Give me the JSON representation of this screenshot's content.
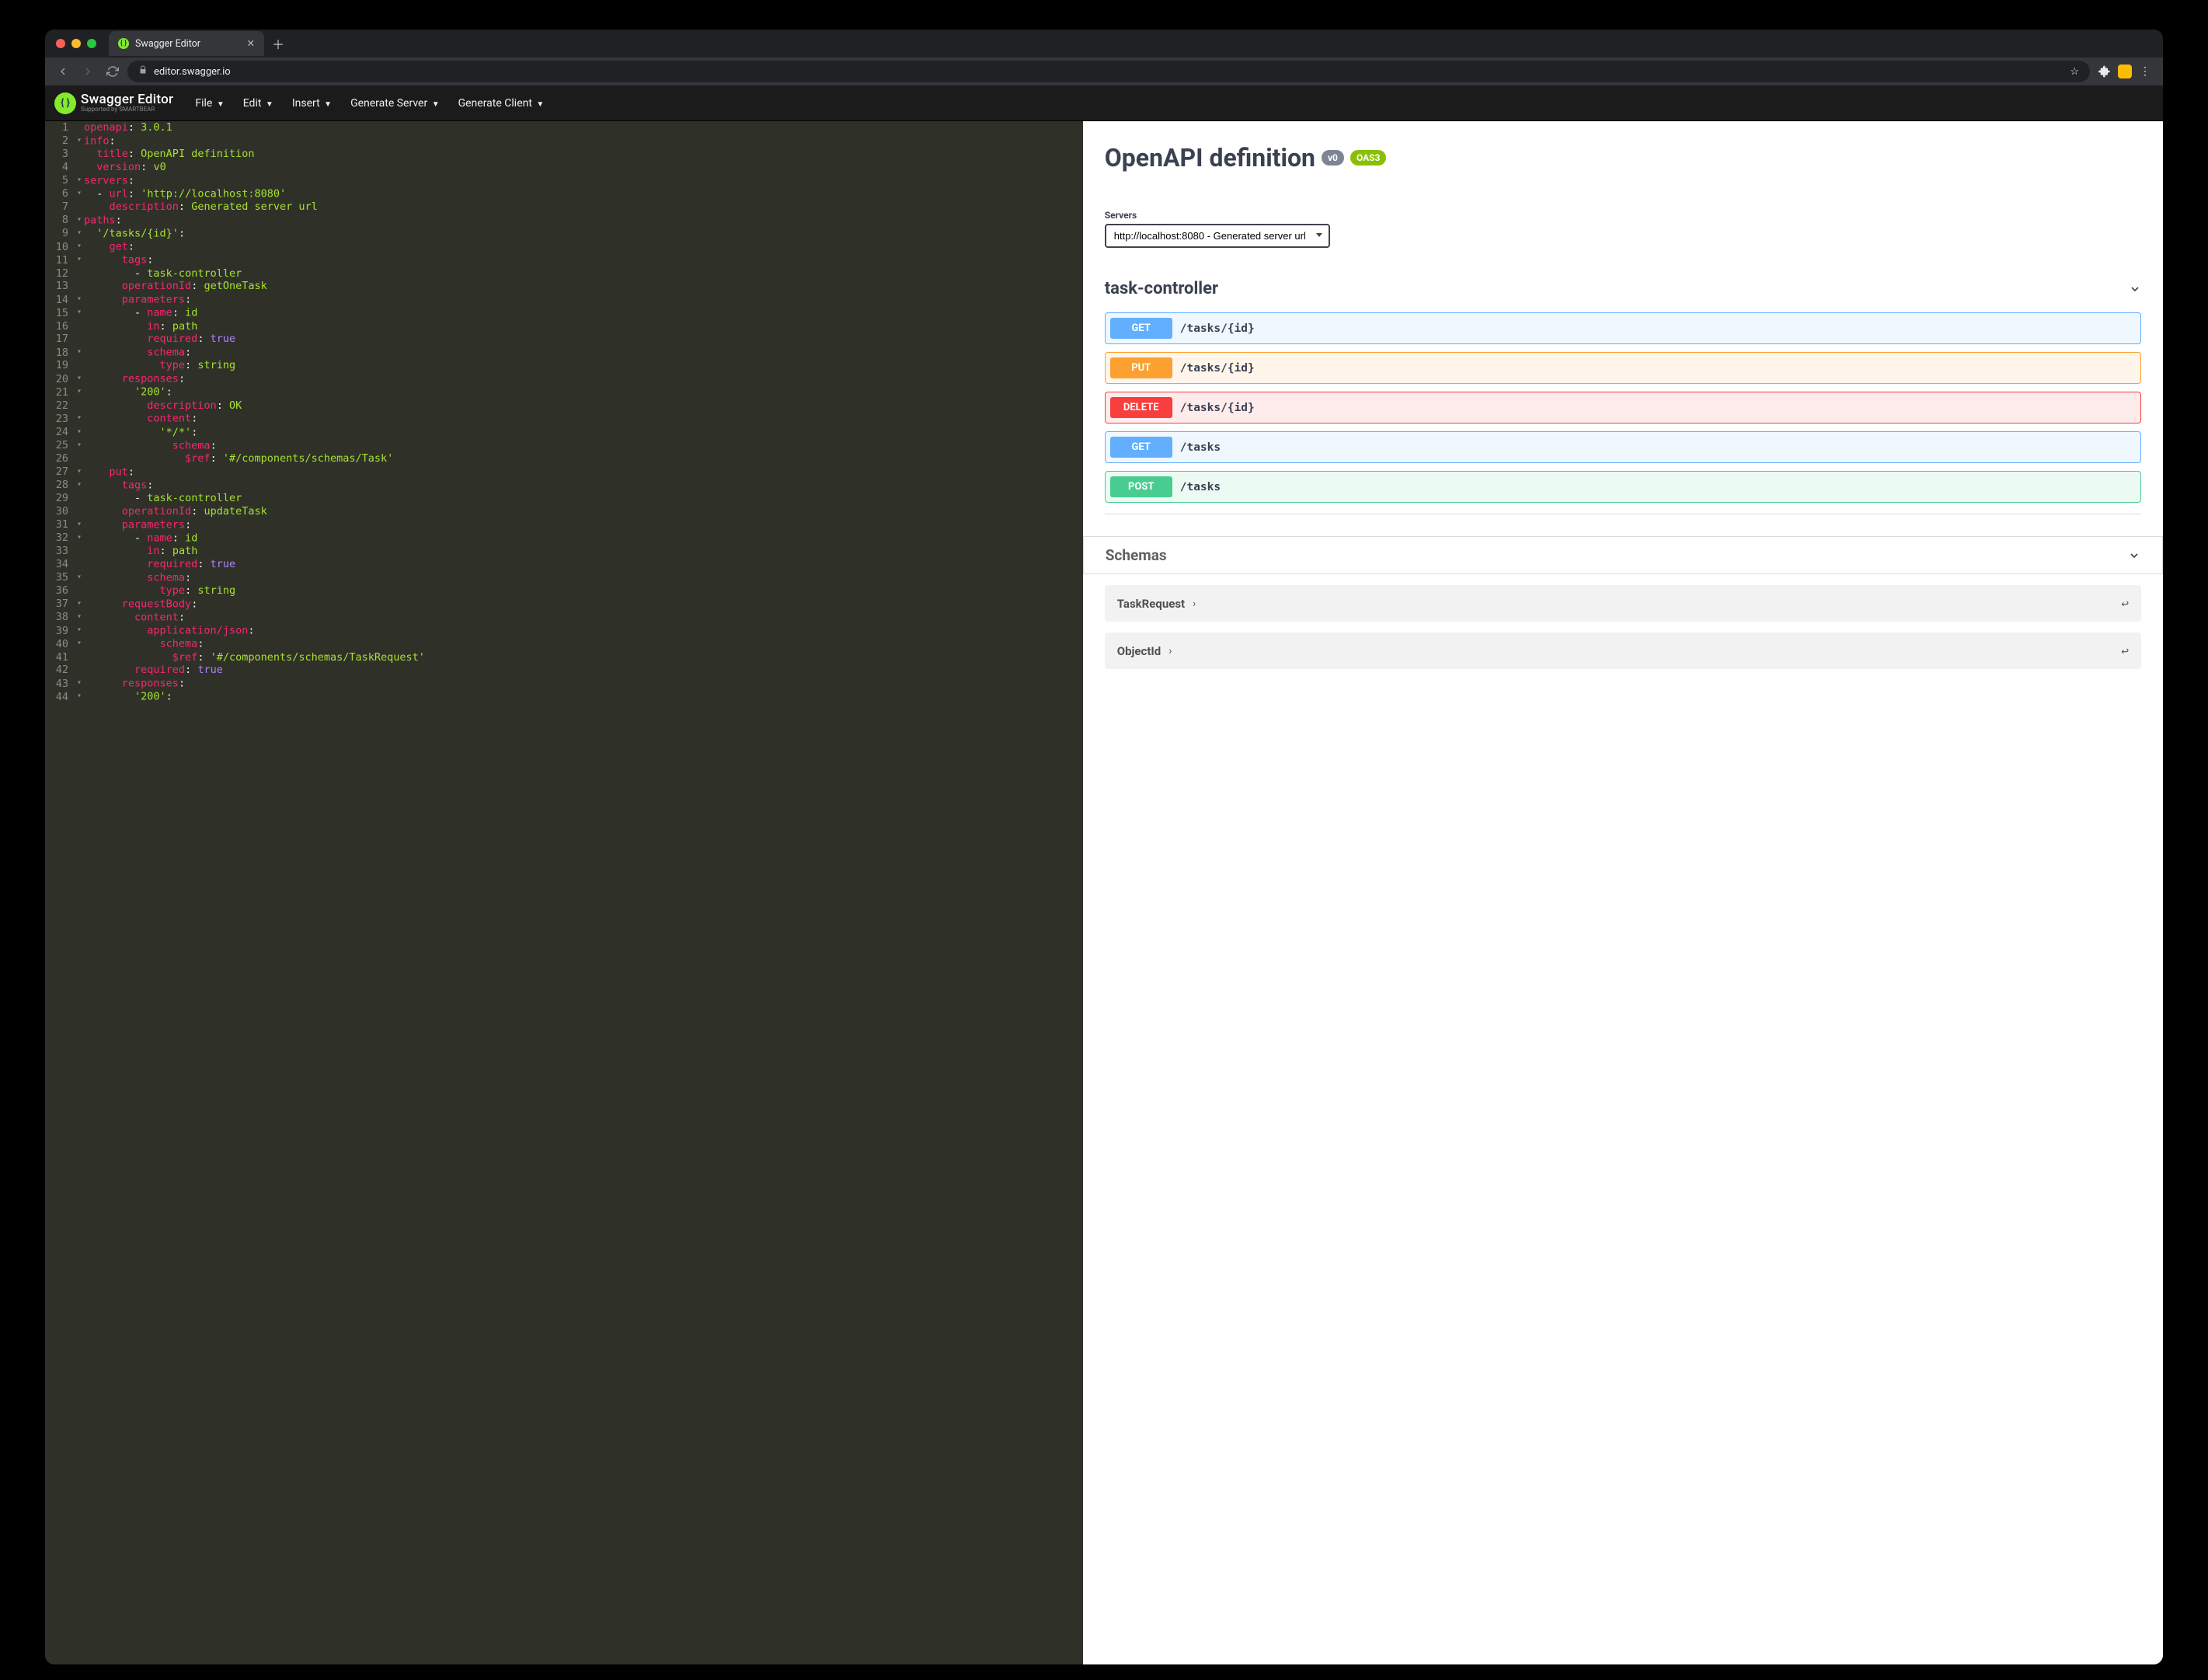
{
  "browser": {
    "tab_title": "Swagger Editor",
    "url": "editor.swagger.io"
  },
  "header": {
    "brand": "Swagger Editor",
    "brand_sub": "Supported by SMARTBEAR",
    "menus": [
      "File",
      "Edit",
      "Insert",
      "Generate Server",
      "Generate Client"
    ]
  },
  "editor": {
    "lines": [
      {
        "n": 1,
        "fold": "",
        "segs": [
          [
            "k-key",
            "openapi"
          ],
          [
            "k-punc",
            ": "
          ],
          [
            "k-str",
            "3.0.1"
          ]
        ]
      },
      {
        "n": 2,
        "fold": "▾",
        "segs": [
          [
            "k-key",
            "info"
          ],
          [
            "k-punc",
            ":"
          ]
        ]
      },
      {
        "n": 3,
        "fold": "",
        "segs": [
          [
            "k-plain",
            "  "
          ],
          [
            "k-key",
            "title"
          ],
          [
            "k-punc",
            ": "
          ],
          [
            "k-str",
            "OpenAPI definition"
          ]
        ]
      },
      {
        "n": 4,
        "fold": "",
        "segs": [
          [
            "k-plain",
            "  "
          ],
          [
            "k-key",
            "version"
          ],
          [
            "k-punc",
            ": "
          ],
          [
            "k-str",
            "v0"
          ]
        ]
      },
      {
        "n": 5,
        "fold": "▾",
        "segs": [
          [
            "k-key",
            "servers"
          ],
          [
            "k-punc",
            ":"
          ]
        ]
      },
      {
        "n": 6,
        "fold": "▾",
        "segs": [
          [
            "k-plain",
            "  "
          ],
          [
            "k-punc",
            "- "
          ],
          [
            "k-key",
            "url"
          ],
          [
            "k-punc",
            ": "
          ],
          [
            "k-str",
            "'http://localhost:8080'"
          ]
        ]
      },
      {
        "n": 7,
        "fold": "",
        "segs": [
          [
            "k-plain",
            "    "
          ],
          [
            "k-key",
            "description"
          ],
          [
            "k-punc",
            ": "
          ],
          [
            "k-str",
            "Generated server url"
          ]
        ]
      },
      {
        "n": 8,
        "fold": "▾",
        "segs": [
          [
            "k-key",
            "paths"
          ],
          [
            "k-punc",
            ":"
          ]
        ]
      },
      {
        "n": 9,
        "fold": "▾",
        "segs": [
          [
            "k-plain",
            "  "
          ],
          [
            "k-str",
            "'/tasks/{id}'"
          ],
          [
            "k-punc",
            ":"
          ]
        ]
      },
      {
        "n": 10,
        "fold": "▾",
        "segs": [
          [
            "k-plain",
            "    "
          ],
          [
            "k-key",
            "get"
          ],
          [
            "k-punc",
            ":"
          ]
        ]
      },
      {
        "n": 11,
        "fold": "▾",
        "segs": [
          [
            "k-plain",
            "      "
          ],
          [
            "k-key",
            "tags"
          ],
          [
            "k-punc",
            ":"
          ]
        ]
      },
      {
        "n": 12,
        "fold": "",
        "segs": [
          [
            "k-plain",
            "        "
          ],
          [
            "k-punc",
            "- "
          ],
          [
            "k-str",
            "task-controller"
          ]
        ]
      },
      {
        "n": 13,
        "fold": "",
        "segs": [
          [
            "k-plain",
            "      "
          ],
          [
            "k-key",
            "operationId"
          ],
          [
            "k-punc",
            ": "
          ],
          [
            "k-str",
            "getOneTask"
          ]
        ]
      },
      {
        "n": 14,
        "fold": "▾",
        "segs": [
          [
            "k-plain",
            "      "
          ],
          [
            "k-key",
            "parameters"
          ],
          [
            "k-punc",
            ":"
          ]
        ]
      },
      {
        "n": 15,
        "fold": "▾",
        "segs": [
          [
            "k-plain",
            "        "
          ],
          [
            "k-punc",
            "- "
          ],
          [
            "k-key",
            "name"
          ],
          [
            "k-punc",
            ": "
          ],
          [
            "k-str",
            "id"
          ]
        ]
      },
      {
        "n": 16,
        "fold": "",
        "segs": [
          [
            "k-plain",
            "          "
          ],
          [
            "k-key",
            "in"
          ],
          [
            "k-punc",
            ": "
          ],
          [
            "k-str",
            "path"
          ]
        ]
      },
      {
        "n": 17,
        "fold": "",
        "segs": [
          [
            "k-plain",
            "          "
          ],
          [
            "k-key",
            "required"
          ],
          [
            "k-punc",
            ": "
          ],
          [
            "k-val",
            "true"
          ]
        ]
      },
      {
        "n": 18,
        "fold": "▾",
        "segs": [
          [
            "k-plain",
            "          "
          ],
          [
            "k-key",
            "schema"
          ],
          [
            "k-punc",
            ":"
          ]
        ]
      },
      {
        "n": 19,
        "fold": "",
        "segs": [
          [
            "k-plain",
            "            "
          ],
          [
            "k-key",
            "type"
          ],
          [
            "k-punc",
            ": "
          ],
          [
            "k-str",
            "string"
          ]
        ]
      },
      {
        "n": 20,
        "fold": "▾",
        "segs": [
          [
            "k-plain",
            "      "
          ],
          [
            "k-key",
            "responses"
          ],
          [
            "k-punc",
            ":"
          ]
        ]
      },
      {
        "n": 21,
        "fold": "▾",
        "segs": [
          [
            "k-plain",
            "        "
          ],
          [
            "k-str",
            "'200'"
          ],
          [
            "k-punc",
            ":"
          ]
        ]
      },
      {
        "n": 22,
        "fold": "",
        "segs": [
          [
            "k-plain",
            "          "
          ],
          [
            "k-key",
            "description"
          ],
          [
            "k-punc",
            ": "
          ],
          [
            "k-str",
            "OK"
          ]
        ]
      },
      {
        "n": 23,
        "fold": "▾",
        "segs": [
          [
            "k-plain",
            "          "
          ],
          [
            "k-key",
            "content"
          ],
          [
            "k-punc",
            ":"
          ]
        ]
      },
      {
        "n": 24,
        "fold": "▾",
        "segs": [
          [
            "k-plain",
            "            "
          ],
          [
            "k-str",
            "'*/*'"
          ],
          [
            "k-punc",
            ":"
          ]
        ]
      },
      {
        "n": 25,
        "fold": "▾",
        "segs": [
          [
            "k-plain",
            "              "
          ],
          [
            "k-key",
            "schema"
          ],
          [
            "k-punc",
            ":"
          ]
        ]
      },
      {
        "n": 26,
        "fold": "",
        "segs": [
          [
            "k-plain",
            "                "
          ],
          [
            "k-key",
            "$ref"
          ],
          [
            "k-punc",
            ": "
          ],
          [
            "k-str",
            "'#/components/schemas/Task'"
          ]
        ]
      },
      {
        "n": 27,
        "fold": "▾",
        "segs": [
          [
            "k-plain",
            "    "
          ],
          [
            "k-key",
            "put"
          ],
          [
            "k-punc",
            ":"
          ]
        ]
      },
      {
        "n": 28,
        "fold": "▾",
        "segs": [
          [
            "k-plain",
            "      "
          ],
          [
            "k-key",
            "tags"
          ],
          [
            "k-punc",
            ":"
          ]
        ]
      },
      {
        "n": 29,
        "fold": "",
        "segs": [
          [
            "k-plain",
            "        "
          ],
          [
            "k-punc",
            "- "
          ],
          [
            "k-str",
            "task-controller"
          ]
        ]
      },
      {
        "n": 30,
        "fold": "",
        "segs": [
          [
            "k-plain",
            "      "
          ],
          [
            "k-key",
            "operationId"
          ],
          [
            "k-punc",
            ": "
          ],
          [
            "k-str",
            "updateTask"
          ]
        ]
      },
      {
        "n": 31,
        "fold": "▾",
        "segs": [
          [
            "k-plain",
            "      "
          ],
          [
            "k-key",
            "parameters"
          ],
          [
            "k-punc",
            ":"
          ]
        ]
      },
      {
        "n": 32,
        "fold": "▾",
        "segs": [
          [
            "k-plain",
            "        "
          ],
          [
            "k-punc",
            "- "
          ],
          [
            "k-key",
            "name"
          ],
          [
            "k-punc",
            ": "
          ],
          [
            "k-str",
            "id"
          ]
        ]
      },
      {
        "n": 33,
        "fold": "",
        "segs": [
          [
            "k-plain",
            "          "
          ],
          [
            "k-key",
            "in"
          ],
          [
            "k-punc",
            ": "
          ],
          [
            "k-str",
            "path"
          ]
        ]
      },
      {
        "n": 34,
        "fold": "",
        "segs": [
          [
            "k-plain",
            "          "
          ],
          [
            "k-key",
            "required"
          ],
          [
            "k-punc",
            ": "
          ],
          [
            "k-val",
            "true"
          ]
        ]
      },
      {
        "n": 35,
        "fold": "▾",
        "segs": [
          [
            "k-plain",
            "          "
          ],
          [
            "k-key",
            "schema"
          ],
          [
            "k-punc",
            ":"
          ]
        ]
      },
      {
        "n": 36,
        "fold": "",
        "segs": [
          [
            "k-plain",
            "            "
          ],
          [
            "k-key",
            "type"
          ],
          [
            "k-punc",
            ": "
          ],
          [
            "k-str",
            "string"
          ]
        ]
      },
      {
        "n": 37,
        "fold": "▾",
        "segs": [
          [
            "k-plain",
            "      "
          ],
          [
            "k-key",
            "requestBody"
          ],
          [
            "k-punc",
            ":"
          ]
        ]
      },
      {
        "n": 38,
        "fold": "▾",
        "segs": [
          [
            "k-plain",
            "        "
          ],
          [
            "k-key",
            "content"
          ],
          [
            "k-punc",
            ":"
          ]
        ]
      },
      {
        "n": 39,
        "fold": "▾",
        "segs": [
          [
            "k-plain",
            "          "
          ],
          [
            "k-key",
            "application/json"
          ],
          [
            "k-punc",
            ":"
          ]
        ]
      },
      {
        "n": 40,
        "fold": "▾",
        "segs": [
          [
            "k-plain",
            "            "
          ],
          [
            "k-key",
            "schema"
          ],
          [
            "k-punc",
            ":"
          ]
        ]
      },
      {
        "n": 41,
        "fold": "",
        "segs": [
          [
            "k-plain",
            "              "
          ],
          [
            "k-key",
            "$ref"
          ],
          [
            "k-punc",
            ": "
          ],
          [
            "k-str",
            "'#/components/schemas/TaskRequest'"
          ]
        ]
      },
      {
        "n": 42,
        "fold": "",
        "segs": [
          [
            "k-plain",
            "        "
          ],
          [
            "k-key",
            "required"
          ],
          [
            "k-punc",
            ": "
          ],
          [
            "k-val",
            "true"
          ]
        ]
      },
      {
        "n": 43,
        "fold": "▾",
        "segs": [
          [
            "k-plain",
            "      "
          ],
          [
            "k-key",
            "responses"
          ],
          [
            "k-punc",
            ":"
          ]
        ]
      },
      {
        "n": 44,
        "fold": "▾",
        "segs": [
          [
            "k-plain",
            "        "
          ],
          [
            "k-str",
            "'200'"
          ],
          [
            "k-punc",
            ":"
          ]
        ]
      }
    ]
  },
  "preview": {
    "title": "OpenAPI definition",
    "version_badge": "v0",
    "oas_badge": "OAS3",
    "servers_label": "Servers",
    "server_selected": "http://localhost:8080 - Generated server url",
    "tag": "task-controller",
    "operations": [
      {
        "method": "GET",
        "path": "/tasks/{id}",
        "cls": "op-get"
      },
      {
        "method": "PUT",
        "path": "/tasks/{id}",
        "cls": "op-put"
      },
      {
        "method": "DELETE",
        "path": "/tasks/{id}",
        "cls": "op-delete"
      },
      {
        "method": "GET",
        "path": "/tasks",
        "cls": "op-get"
      },
      {
        "method": "POST",
        "path": "/tasks",
        "cls": "op-post"
      }
    ],
    "schemas_label": "Schemas",
    "schemas": [
      "TaskRequest",
      "ObjectId"
    ]
  }
}
